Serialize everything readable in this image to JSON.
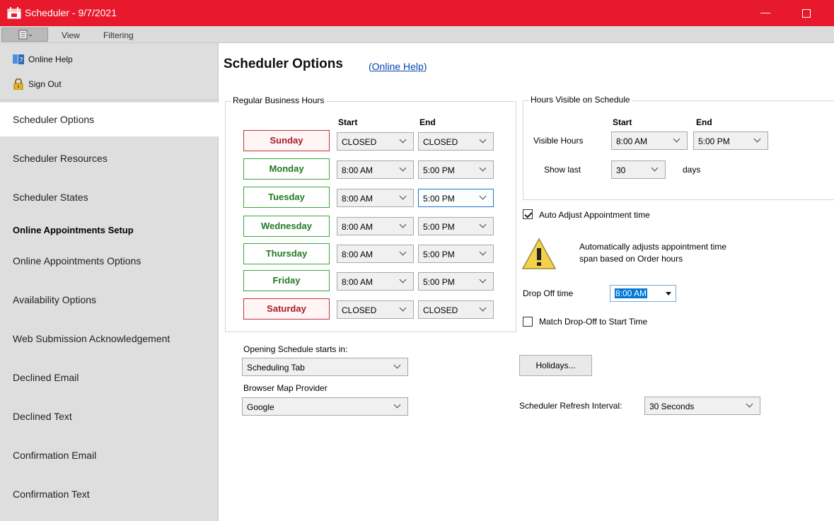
{
  "window": {
    "title": "Scheduler - 9/7/2021",
    "minimize_glyph": "—"
  },
  "menu": {
    "view": "View",
    "filtering": "Filtering"
  },
  "sidebar": {
    "tools": [
      {
        "label": "Online Help",
        "icon": "help-book-icon"
      },
      {
        "label": "Sign Out",
        "icon": "padlock-icon"
      }
    ],
    "items": [
      {
        "label": "Scheduler Options",
        "active": true
      },
      {
        "label": "Scheduler Resources"
      },
      {
        "label": "Scheduler States"
      }
    ],
    "section": "Online Appointments Setup",
    "section_items": [
      {
        "label": "Online Appointments Options"
      },
      {
        "label": "Availability Options"
      },
      {
        "label": "Web Submission Acknowledgement"
      },
      {
        "label": "Declined Email"
      },
      {
        "label": "Declined Text"
      },
      {
        "label": "Confirmation Email"
      },
      {
        "label": "Confirmation Text"
      }
    ]
  },
  "main": {
    "title": "Scheduler Options",
    "help_open": "(",
    "help_link": "Online Help",
    "help_close": ")",
    "business_hours": {
      "legend": "Regular Business Hours",
      "start_header": "Start",
      "end_header": "End",
      "days": [
        {
          "name": "Sunday",
          "start": "CLOSED",
          "end": "CLOSED",
          "closed": true
        },
        {
          "name": "Monday",
          "start": "8:00 AM",
          "end": "5:00 PM"
        },
        {
          "name": "Tuesday",
          "start": "8:00 AM",
          "end": "5:00 PM"
        },
        {
          "name": "Wednesday",
          "start": "8:00 AM",
          "end": "5:00 PM"
        },
        {
          "name": "Thursday",
          "start": "8:00 AM",
          "end": "5:00 PM"
        },
        {
          "name": "Friday",
          "start": "8:00 AM",
          "end": "5:00 PM"
        },
        {
          "name": "Saturday",
          "start": "CLOSED",
          "end": "CLOSED",
          "closed": true
        }
      ]
    },
    "visible_hours": {
      "legend": "Hours Visible on Schedule",
      "start_header": "Start",
      "end_header": "End",
      "visible_label": "Visible Hours",
      "start": "8:00 AM",
      "end": "5:00 PM",
      "show_last_label": "Show last",
      "show_last_value": "30",
      "days_label": "days"
    },
    "auto_adjust": {
      "label": "Auto Adjust Appointment time",
      "checked": true,
      "note_line1": "Automatically adjusts appointment time",
      "note_line2": "span based on Order hours"
    },
    "dropoff": {
      "label": "Drop Off time",
      "value": "8:00 AM"
    },
    "match_dropoff": {
      "label": "Match Drop-Off to Start Time",
      "checked": false
    },
    "opening_schedule": {
      "label": "Opening Schedule starts in:",
      "value": "Scheduling Tab"
    },
    "map_provider": {
      "label": "Browser Map Provider",
      "value": "Google"
    },
    "holidays_button": "Holidays...",
    "refresh": {
      "label": "Scheduler Refresh Interval:",
      "value": "30 Seconds"
    }
  },
  "colors": {
    "titlebar": "#e8192c",
    "open_day": "#237a23",
    "closed_day": "#a51e26",
    "link": "#0645ad"
  }
}
